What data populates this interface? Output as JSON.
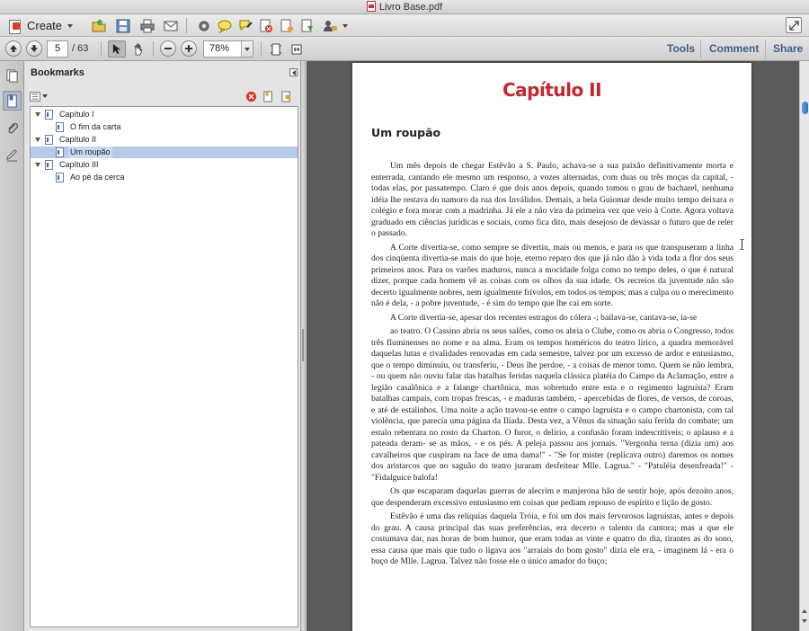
{
  "window": {
    "title": "Livro Base.pdf"
  },
  "toolbar": {
    "create_label": "Create",
    "icons": [
      "open-folder-icon",
      "save-icon",
      "print-icon",
      "email-icon",
      "gear-icon",
      "comment-bubble-icon",
      "highlight-icon",
      "delete-page-icon",
      "export-page-icon",
      "sign-icon",
      "share-user-icon"
    ]
  },
  "navbar": {
    "page_current": "5",
    "page_total": "/ 63",
    "zoom": "78%",
    "links": {
      "tools": "Tools",
      "comment": "Comment",
      "share": "Share"
    }
  },
  "bookmarks": {
    "title": "Bookmarks",
    "items": [
      {
        "label": "Capítulo I",
        "level": 0,
        "expanded": true
      },
      {
        "label": "O  fim da carta",
        "level": 1
      },
      {
        "label": "Capítulo II",
        "level": 0,
        "expanded": true
      },
      {
        "label": "Um  roupão",
        "level": 1,
        "selected": true
      },
      {
        "label": "Capítulo III",
        "level": 0,
        "expanded": true
      },
      {
        "label": "Ao  pé  da cerca",
        "level": 1
      }
    ]
  },
  "document": {
    "chapter_title": "Capítulo II",
    "section_title": "Um  roupão",
    "paragraphs": [
      "Um   mês  depois de chegar Estêvão a  S. Paulo,  achava-se a  sua  paixão definitivamente morta  e enterrada, cantando ele mesmo  um  responso, a vozes  alternadas, com duas ou  três moças da  capital, -  todas elas, por  passatempo. Claro é que dois anos depois, quando tomou o grau  de bacharel, nenhuma  idéia lhe restava do  namoro da  rua  dos Inválidos. Demais, a  bela Guiomar desde muito tempo deixara o colégio e fora morar com a madrinha. Já  ele a não  vira da  primeira vez  que veio à  Corte. Agora voltava graduado em  ciências  jurídicas e sociais, como fica  dito, mais desejoso de devassar o futuro que de reler o passado.",
      "A  Corte divertia-se, como sempre se divertiu, mais ou  menos, e para  os  que transpuseram a linha dos  cinqüenta divertia-se mais do  que hoje, eterno reparo dos  que já não  dão  à vida toda  a flor  dos seus  primeiros anos. Para  os  varões maduros, nunca a  mocidade folga como no  tempo deles, o  que é natural   dizer, porque cada homem  vê  as coisas  com os olhos da sua idade. Os recreios  da  juventude não  são  decerto  igualmente nobres, nem igualmente frívolos, em todos os tempos;  mas a culpa ou  o merecimento  não  é dela, - a pobre juventude, - é sim do tempo que lhe cai  em sorte.",
      "A  Corte divertia-se, apesar dos recentes estragos  do  cólera -;  bailava-se, cantava-se,  ia-se",
      "ao  teatro.  O  Cassino abria  os  seus salões, como os  abria  o  Clube, como os  abria  o  Congresso, todos  três fluminenses no  nome e na  alma. Eram os  tempos homéricos do teatro  lírico, a quadra memorável daquelas lutas   e rivalidades renovadas em  cada semestre,  talvez por  um excesso de ardor  e entusiasmo, que o tempo diminuiu, ou  transferiu, - Deus lhe  perdoe, - a coisas de  menor tomo.  Quem  se  não  lembra,  -  ou  quem  não  ouviu  falar das  batalhas  feridas naquela clássica platéia do  Campo da  Aclamação, entre a legião casalônica e a falange chartônica, mas sobretudo entre esta e  o  regimento  lagruísta?  Eram  batalhas  campais,  com  tropas  frescas,  -  e maduras também,  -   apercebidas  de flores, de versos,  de  coroas, e até  de estalinhos. Uma noite a  ação travou-se  entre  o  campo lagruísta e  o  campo  chartonista, com  tal  violência,  que parecia uma página da  Ilíada. Desta vez,  a Vênus da  situação saiu ferida do  combate; um  estalo rebentara no rosto  da Charton.  O  furor, o delírio, a confusão foram indescritíveis; o aplauso e a pateada deram- se as  mãos,  -  e os pés. A  peleja passou aos jornais. \"Vergonha terna  (dizia um) aos cavalheiros que   cuspiram na  face de  uma dama!\" -  \"Se for mister (replicava outro)  daremos os  nomes dos aristarcos que no  saguão do  teatro  juraram desfeitear Mlle. Lagrua.\" - \"Patuléia desenfreada!\"  -  \"Fidalguice balofa!",
      "Os que  escaparam  daquelas guerras de  alecrim  e  manjerona hão  de  sentir hoje,  após dezoito anos, que despenderam excessivo  entusiasmo em coisas que pediam repouso de espírito e lição de  gosto.",
      "Estêvão é uma das relíquias daquela Tróia,  e foi  um  dos  mais fervorosos  lagruístas, antes e depois do  grau.  A  causa principal das  suas preferências,  era decerto o talento da  cantora; mas a que  ele costumava dar,  nas horas de  bom humor,  que  eram todas as vinte e quatro  do  dia, tirantes as do  sono, essa  causa que mais que tudo  o  ligava aos \"arraiais do  bom gosto\" dizia ele era, - imaginem lá  -  era  o buço de  Mlle. Lagrua. Talvez  não  fosse ele o  único amador do  buço;"
    ]
  }
}
